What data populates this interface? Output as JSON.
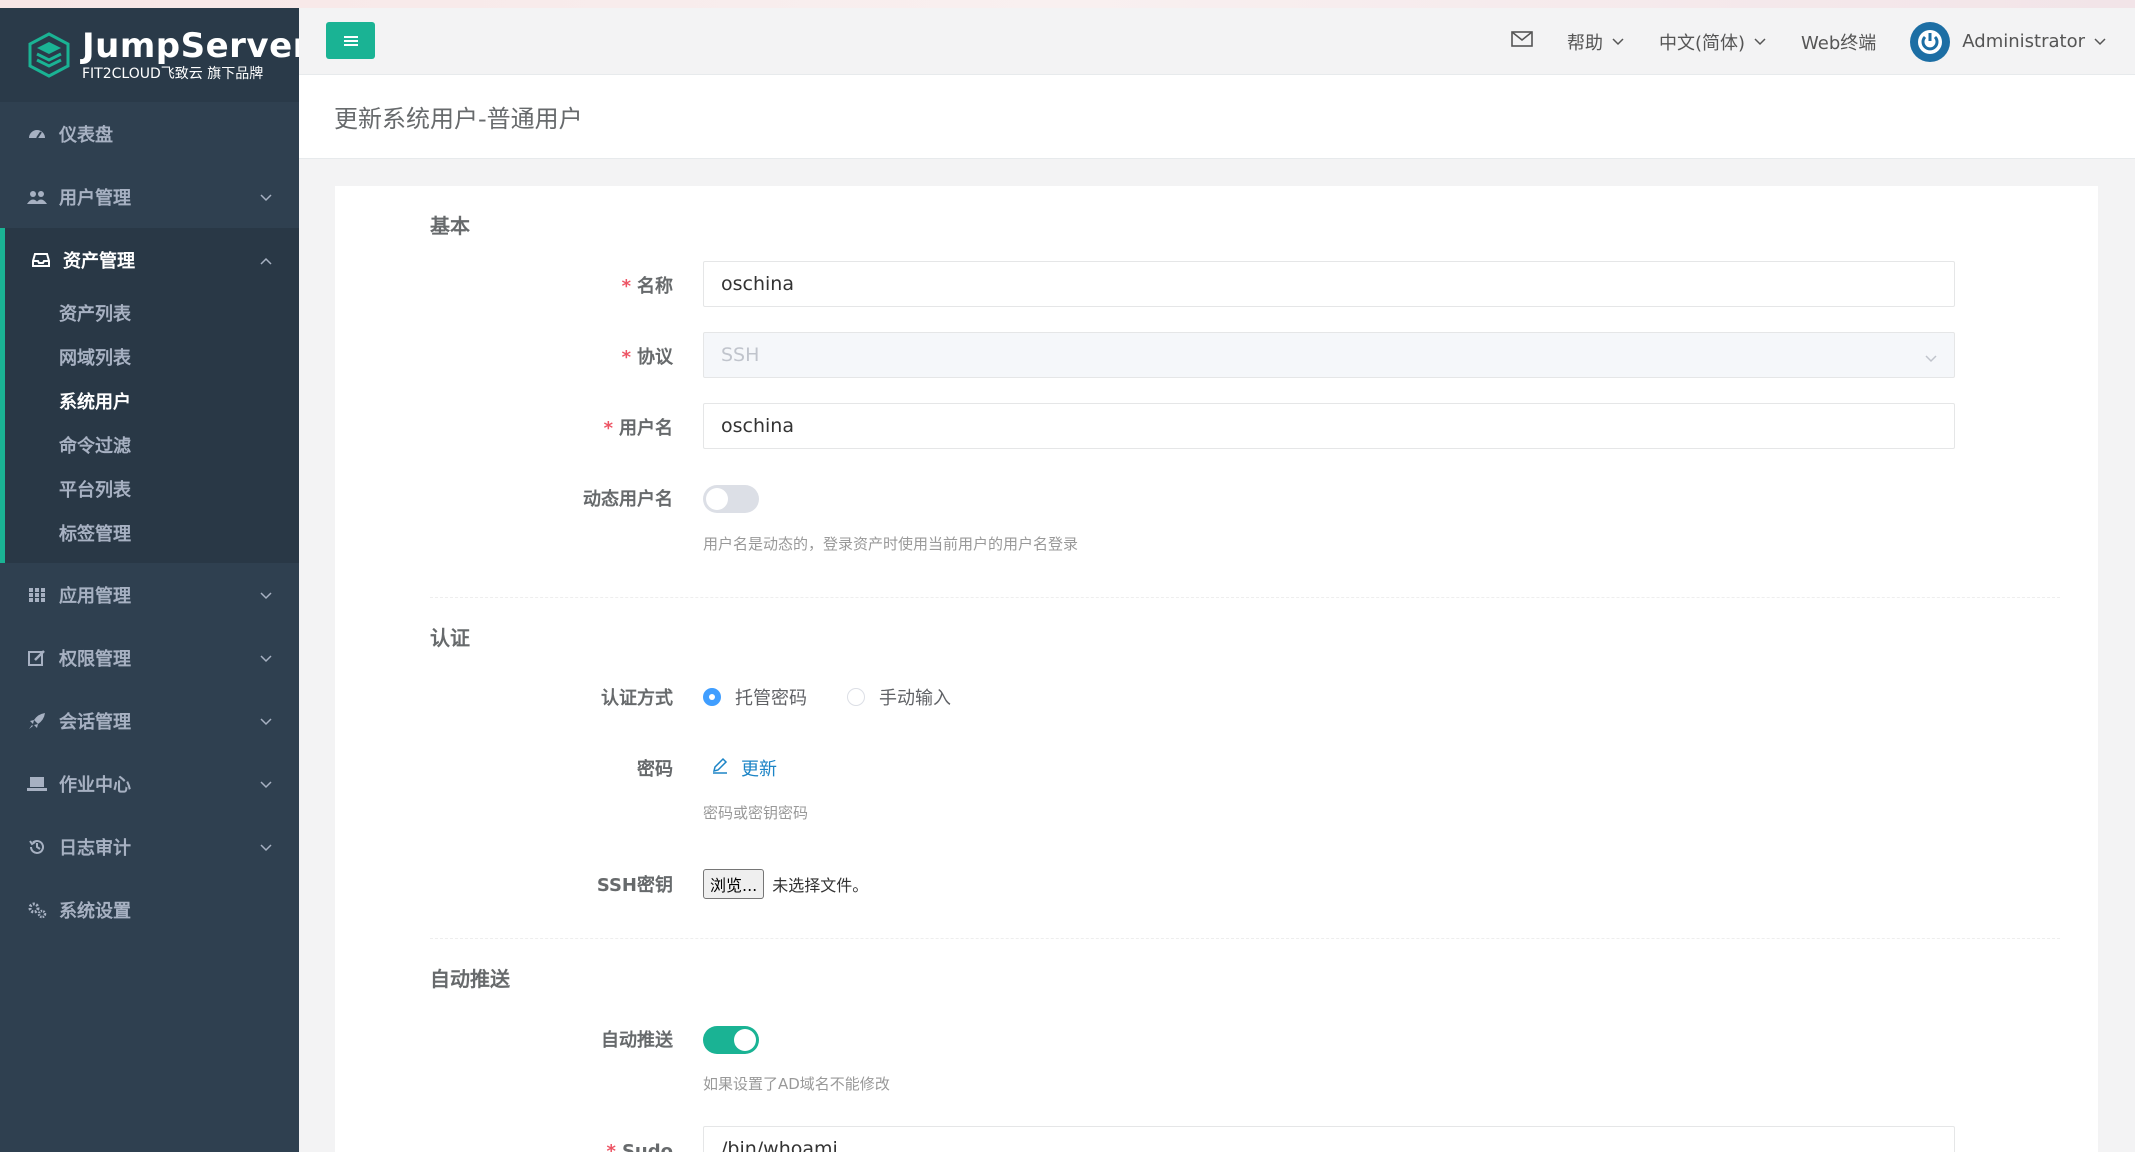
{
  "app": {
    "logo_title": "JumpServer",
    "logo_subtitle": "FIT2CLOUD飞致云 旗下品牌"
  },
  "sidebar": {
    "items": [
      {
        "label": "仪表盘",
        "icon": "dashboard-icon"
      },
      {
        "label": "用户管理",
        "icon": "users-icon"
      },
      {
        "label": "资产管理",
        "icon": "inbox-icon",
        "expanded": true,
        "children": [
          "资产列表",
          "网域列表",
          "系统用户",
          "命令过滤",
          "平台列表",
          "标签管理"
        ],
        "active_child": "系统用户"
      },
      {
        "label": "应用管理",
        "icon": "grid-icon"
      },
      {
        "label": "权限管理",
        "icon": "edit-icon"
      },
      {
        "label": "会话管理",
        "icon": "rocket-icon"
      },
      {
        "label": "作业中心",
        "icon": "laptop-icon"
      },
      {
        "label": "日志审计",
        "icon": "history-icon"
      },
      {
        "label": "系统设置",
        "icon": "gears-icon"
      }
    ]
  },
  "topbar": {
    "help": "帮助",
    "language": "中文(简体)",
    "web_terminal": "Web终端",
    "user": "Administrator"
  },
  "page": {
    "title": "更新系统用户-普通用户"
  },
  "form": {
    "section_basic": "基本",
    "name_label": "名称",
    "name_value": "oschina",
    "protocol_label": "协议",
    "protocol_value": "SSH",
    "username_label": "用户名",
    "username_value": "oschina",
    "dynamic_username_label": "动态用户名",
    "dynamic_username_on": false,
    "dynamic_username_help": "用户名是动态的，登录资产时使用当前用户的用户名登录",
    "section_auth": "认证",
    "auth_method_label": "认证方式",
    "auth_method_options": [
      "托管密码",
      "手动输入"
    ],
    "auth_method_selected": "托管密码",
    "password_label": "密码",
    "password_update": "更新",
    "password_help": "密码或密钥密码",
    "ssh_key_label": "SSH密钥",
    "file_button": "浏览...",
    "file_status": "未选择文件。",
    "section_push": "自动推送",
    "auto_push_label": "自动推送",
    "auto_push_on": true,
    "auto_push_help": "如果设置了AD域名不能修改",
    "sudo_label": "Sudo",
    "sudo_value": "/bin/whoami"
  },
  "colors": {
    "sidebar_bg": "#2f4050",
    "accent": "#1ab394",
    "link": "#1c84c6",
    "required": "#ed5565"
  }
}
